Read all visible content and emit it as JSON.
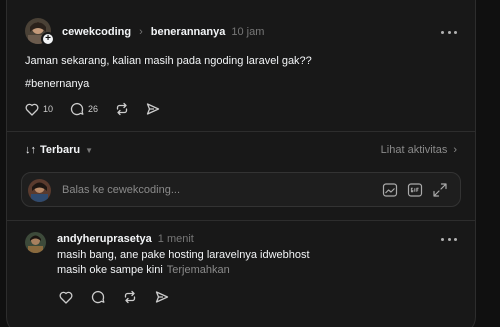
{
  "post": {
    "author": "cewekcoding",
    "topic": "benerannanya",
    "timestamp": "10 jam",
    "text": "Jaman sekarang, kalian masih pada ngoding laravel gak??",
    "hashtag": "#benernanya",
    "likes": "10",
    "comments": "26"
  },
  "sort": {
    "label": "Terbaru",
    "activity_link": "Lihat aktivitas"
  },
  "reply": {
    "placeholder": "Balas ke cewekcoding..."
  },
  "comment": {
    "author": "andyheruprasetya",
    "timestamp": "1 menit",
    "line1": "masih bang, ane pake hosting laravelnya idwebhost",
    "line2": "masih oke sampe kini",
    "translate": "Terjemahkan"
  },
  "icons": [
    "more-icon",
    "heart-icon",
    "comment-icon",
    "repost-icon",
    "share-icon",
    "sort-icon",
    "chevron-down-icon",
    "chevron-right-icon",
    "gif-icon",
    "image-icon",
    "expand-icon"
  ]
}
